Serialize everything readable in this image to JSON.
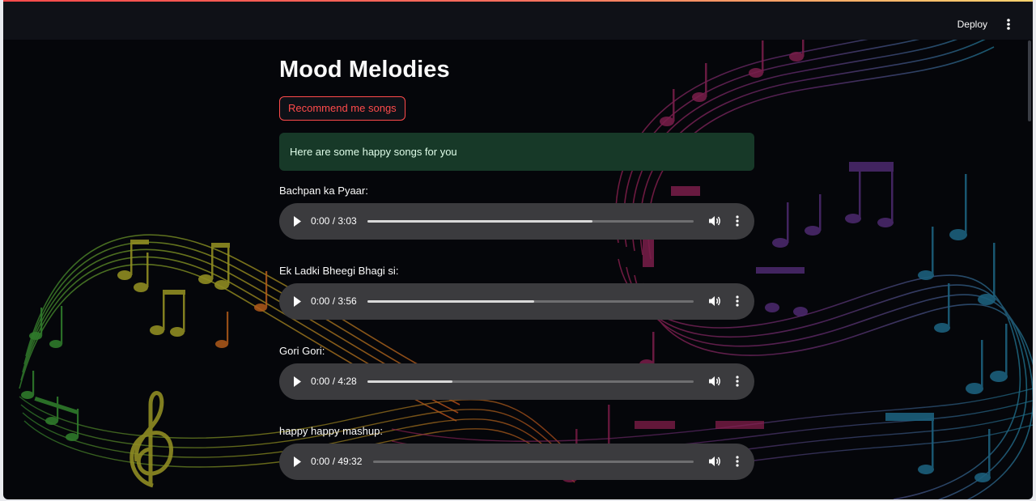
{
  "header": {
    "deploy_label": "Deploy",
    "menu_icon": "vertical-dots-icon"
  },
  "main": {
    "title": "Mood Melodies",
    "recommend_button_label": "Recommend me songs",
    "success_message": "Here are some happy songs for you"
  },
  "songs": [
    {
      "label": "Bachpan ka Pyaar:",
      "time": "0:00 / 3:03",
      "progress": 0.69
    },
    {
      "label": "Ek Ladki Bheegi Bhagi si:",
      "time": "0:00 / 3:56",
      "progress": 0.51
    },
    {
      "label": "Gori Gori:",
      "time": "0:00 / 4:28",
      "progress": 0.26
    },
    {
      "label": "happy happy mashup:",
      "time": "0:00 / 49:32",
      "progress": 0.0
    }
  ],
  "colors": {
    "accent": "#ff4b4b",
    "background": "#05060a",
    "header_bg": "#0f1117",
    "success_bg": "#173928",
    "player_bg": "#3b3b3e"
  },
  "icons": {
    "play": "play-icon",
    "volume": "volume-icon",
    "more": "vertical-dots-icon"
  }
}
